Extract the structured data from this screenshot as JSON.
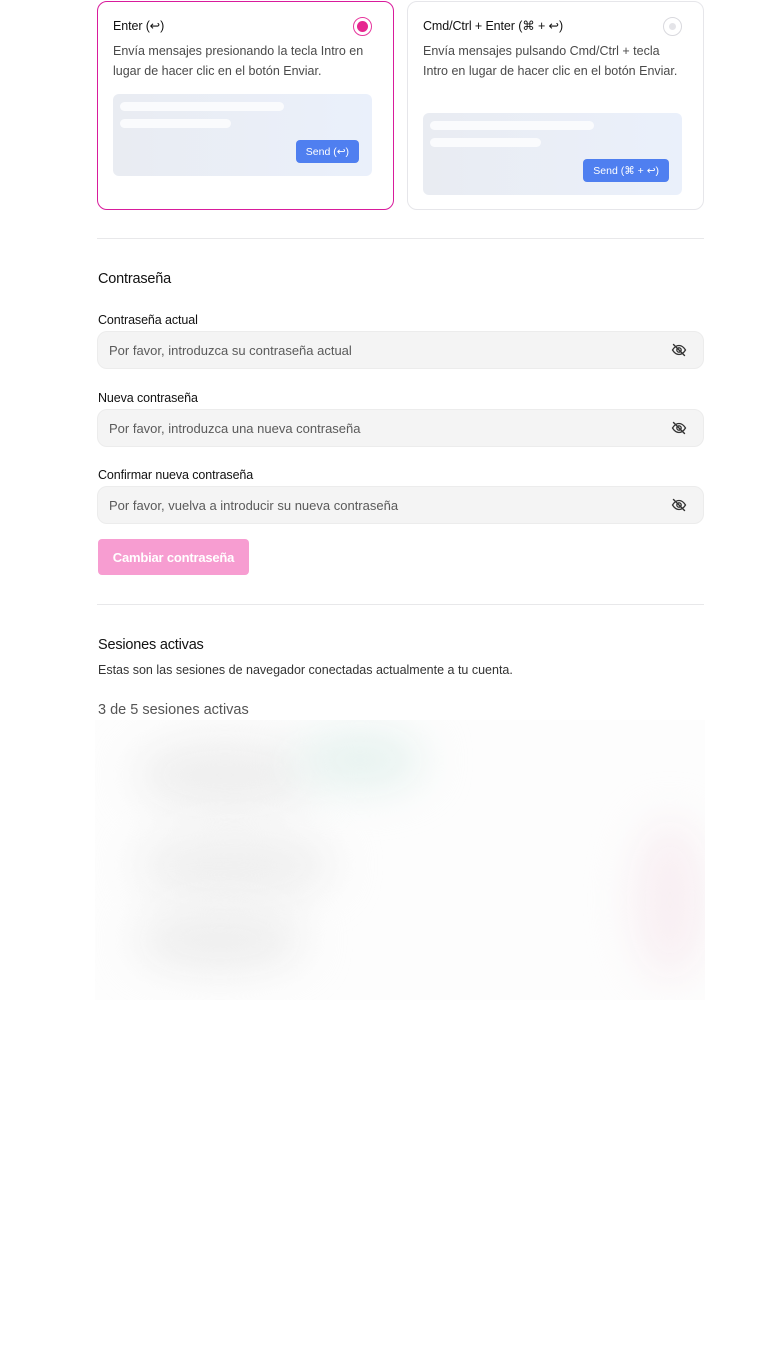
{
  "send_modes": [
    {
      "title": "Enter (↩)",
      "description": "Envía mensajes presionando la tecla Intro en lugar de hacer clic en el botón Enviar.",
      "button": "Send (↩)",
      "selected": true
    },
    {
      "title": "Cmd/Ctrl + Enter (⌘ + ↩)",
      "description": "Envía mensajes pulsando Cmd/Ctrl + tecla Intro en lugar de hacer clic en el botón Enviar.",
      "button": "Send (⌘ + ↩)",
      "selected": false
    }
  ],
  "password": {
    "title": "Contraseña",
    "current_label": "Contraseña actual",
    "current_placeholder": "Por favor, introduzca su contraseña actual",
    "new_label": "Nueva contraseña",
    "new_placeholder": "Por favor, introduzca una nueva contraseña",
    "confirm_label": "Confirmar nueva contraseña",
    "confirm_placeholder": "Por favor, vuelva a introducir su nueva contraseña",
    "submit_label": "Cambiar contraseña",
    "visibility_icon": "eye-off-icon"
  },
  "sessions": {
    "title": "Sesiones activas",
    "description": "Estas son las sesiones de navegador conectadas actualmente a tu cuenta.",
    "count_text": "3 de 5 sesiones activas"
  },
  "colors": {
    "accent": "#e6278f",
    "send_button": "#4f7ff0",
    "submit_disabled": "#f79dd1"
  }
}
